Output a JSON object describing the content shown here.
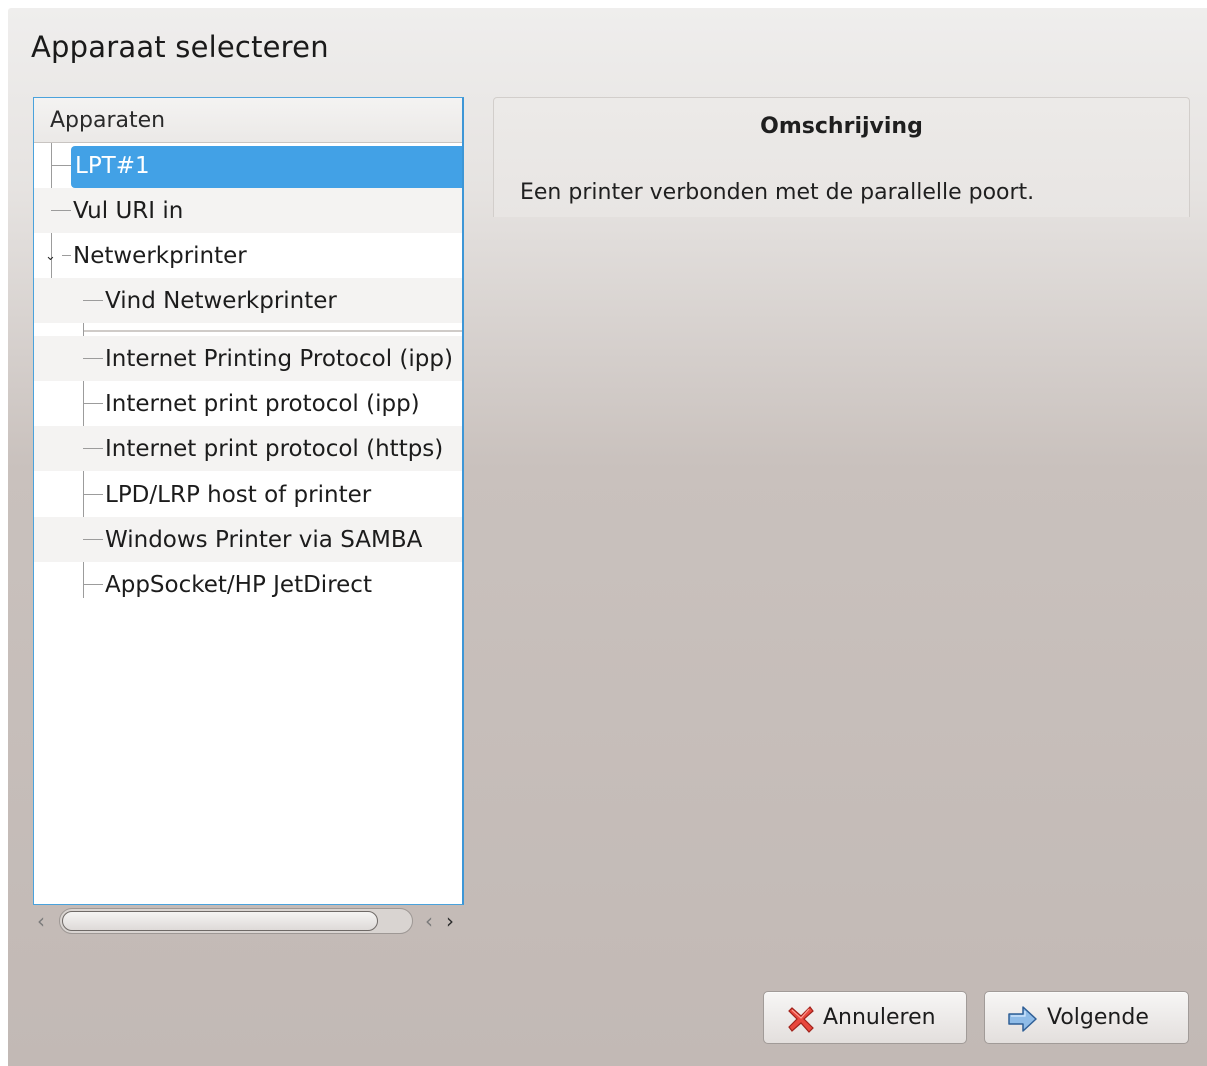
{
  "window": {
    "title": "Apparaat selecteren"
  },
  "tree": {
    "header": "Apparaten",
    "items": [
      {
        "label": "LPT#1",
        "selected": true
      },
      {
        "label": "Vul URI in"
      },
      {
        "label": "Netwerkprinter",
        "expanded": true
      },
      {
        "label": "Vind Netwerkprinter"
      },
      {
        "label": "Internet Printing Protocol (ipp)"
      },
      {
        "label": "Internet print protocol (ipp)"
      },
      {
        "label": "Internet print protocol (https)"
      },
      {
        "label": "LPD/LRP host of printer"
      },
      {
        "label": "Windows Printer via SAMBA"
      },
      {
        "label": "AppSocket/HP JetDirect"
      }
    ],
    "selection_color": "#42a1e6"
  },
  "description": {
    "title": "Omschrijving",
    "text": "Een printer verbonden met de parallelle poort."
  },
  "buttons": {
    "cancel": {
      "label": "Annuleren",
      "icon": "red-x-icon"
    },
    "next": {
      "label": "Volgende",
      "icon": "blue-arrow-right-icon"
    }
  }
}
